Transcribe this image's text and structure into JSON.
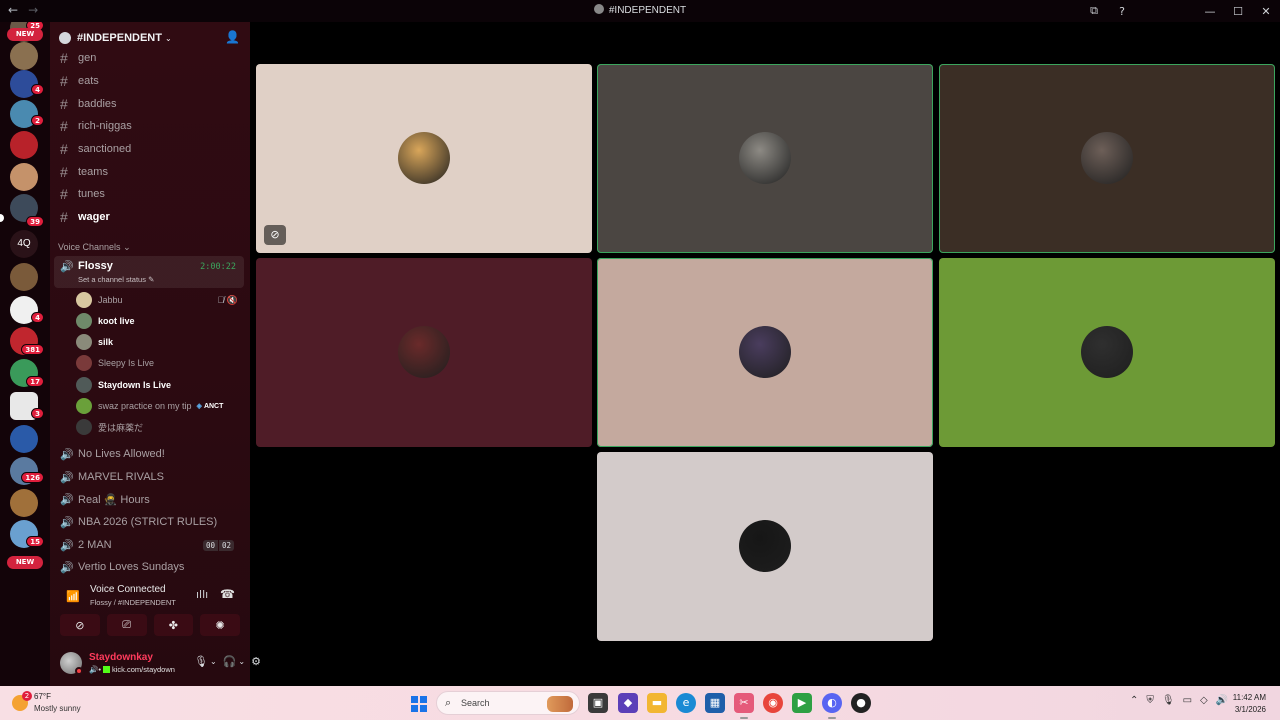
{
  "window": {
    "title": "#INDEPENDENT",
    "back": "←",
    "forward": "→"
  },
  "rail": {
    "badges": [
      "25",
      "4",
      "2",
      "39",
      "4",
      "381",
      "17",
      "3",
      "126",
      "15"
    ],
    "new_label": "NEW",
    "text_server": "4Q"
  },
  "server": {
    "name": "#INDEPENDENT",
    "chevron": "⌄"
  },
  "text_channels": [
    {
      "name": "gen",
      "unread": false
    },
    {
      "name": "eats",
      "unread": false
    },
    {
      "name": "baddies",
      "unread": false
    },
    {
      "name": "rich-niggas",
      "unread": false
    },
    {
      "name": "sanctioned",
      "unread": false
    },
    {
      "name": "teams",
      "unread": false
    },
    {
      "name": "tunes",
      "unread": false
    },
    {
      "name": "wager",
      "unread": true
    }
  ],
  "voice_category": "Voice Channels",
  "active_voice": {
    "name": "Flossy",
    "timer": "2:00:22",
    "status": "Set a channel status",
    "members": [
      {
        "name": "Jabbu",
        "speaking": false,
        "color": "#d8c7a0",
        "icons": "🎙̸ 🔇"
      },
      {
        "name": "koot live",
        "speaking": true,
        "color": "#6f8a6a"
      },
      {
        "name": "silk",
        "speaking": true,
        "color": "#8a8a7a"
      },
      {
        "name": "Sleepy Is Live",
        "speaking": false,
        "color": "#7a3a3a"
      },
      {
        "name": "Staydown Is Live",
        "speaking": true,
        "color": "#505a58"
      },
      {
        "name": "swaz practice on my tip",
        "speaking": false,
        "color": "#6aa03a",
        "tag": "ANCT"
      },
      {
        "name": "愛は麻薬だ",
        "speaking": false,
        "color": "#3a3a3a"
      }
    ]
  },
  "voice_channels": [
    {
      "name": "No Lives Allowed!"
    },
    {
      "name": "MARVEL RIVALS"
    },
    {
      "name": "Real 🥷 Hours"
    },
    {
      "name": "NBA 2026 (STRICT RULES)"
    },
    {
      "name": "2 MAN",
      "counter": [
        "00",
        "02"
      ]
    },
    {
      "name": "Vertio Loves Sundays"
    }
  ],
  "voice_panel": {
    "title": "Voice Connected",
    "subtitle": "Flossy / #INDEPENDENT"
  },
  "user": {
    "name": "Staydownkay",
    "status": "kick.com/staydown"
  },
  "tiles": [
    {
      "bg": "#e0d0c6",
      "avatar": "#d9a65a",
      "speaking": false,
      "has_tag": true
    },
    {
      "bg": "#4b4642",
      "avatar": "#8d8a84",
      "speaking": true,
      "has_tag": false
    },
    {
      "bg": "#3b2e25",
      "avatar": "#6d5f58",
      "speaking": true,
      "has_tag": false
    },
    {
      "bg": "#4f1c27",
      "avatar": "#6a2a2a",
      "speaking": false,
      "has_tag": false
    },
    {
      "bg": "#c4a99e",
      "avatar": "#4a3d5e",
      "speaking": true,
      "has_tag": false
    },
    {
      "bg": "#6d9a36",
      "avatar": "#2f2f2f",
      "speaking": false,
      "has_tag": false
    },
    {
      "bg": "#d3cbca",
      "avatar": "#161616",
      "speaking": false,
      "has_tag": false
    }
  ],
  "taskbar": {
    "weather_temp": "67°F",
    "weather_cond": "Mostly sunny",
    "weather_badge": "2",
    "search_placeholder": "Search",
    "time": "11:42 AM",
    "date": "3/1/2026"
  }
}
